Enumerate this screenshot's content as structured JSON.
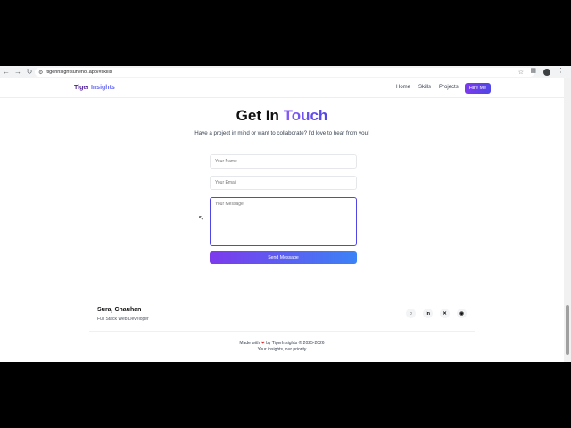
{
  "browser": {
    "url": "tigerinsightsunenol.app/#skills",
    "back_icon": "arrow-left-icon",
    "forward_icon": "arrow-right-icon",
    "reload_icon": "reload-icon"
  },
  "site_nav": {
    "brand_part1": "Tiger",
    "brand_part2": "Insights",
    "links": [
      "Home",
      "Skills",
      "Projects"
    ],
    "cta": "Hire Me"
  },
  "contact": {
    "title_part1": "Get In",
    "title_part2": "Touch",
    "subtitle": "Have a project in mind or want to collaborate? I'd love to hear from you!",
    "name_placeholder": "Your Name",
    "email_placeholder": "Your Email",
    "message_placeholder": "Your Message",
    "send_label": "Send Message"
  },
  "footer": {
    "name": "Suraj Chauhan",
    "role": "Full Stack Web Developer",
    "social_icons": [
      "github-icon",
      "linkedin-icon",
      "x-icon",
      "discord-icon"
    ],
    "made_with": "Made with",
    "made_by": "by TigerInsights © 2025-2026",
    "tagline": "Your insights, our priority"
  },
  "colors": {
    "accent_purple": "#7c3aed",
    "accent_blue": "#4f46e5"
  }
}
